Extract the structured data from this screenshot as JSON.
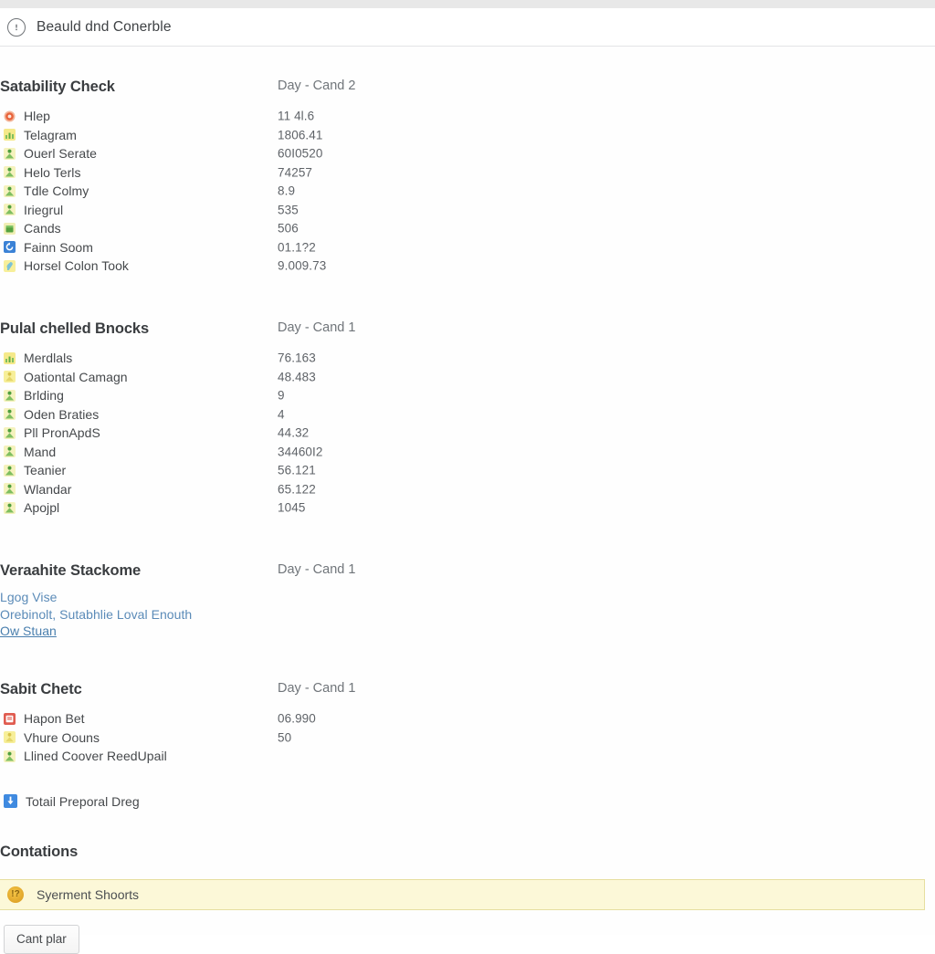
{
  "header": {
    "icon": "info-circle-icon",
    "title": "Beauld dnd Conerble"
  },
  "sections": [
    {
      "id": "satability-check",
      "title": "Satability Check",
      "meta": "Day - Cand 2",
      "rows": [
        {
          "icon": "orange-target-icon",
          "label": "Hlep",
          "value": "11 4l.6"
        },
        {
          "icon": "green-chart-icon",
          "label": "Telagram",
          "value": "1806.41"
        },
        {
          "icon": "green-person-icon",
          "label": "Ouerl Serate",
          "value": "60I0520"
        },
        {
          "icon": "green-person-icon",
          "label": "Helo Terls",
          "value": "74257"
        },
        {
          "icon": "green-person-icon",
          "label": "Tdle Colmy",
          "value": "8.9"
        },
        {
          "icon": "green-person-icon",
          "label": "Iriegrul",
          "value": "535"
        },
        {
          "icon": "green-box-icon",
          "label": "Cands",
          "value": "506"
        },
        {
          "icon": "blue-refresh-icon",
          "label": "Fainn Soom",
          "value": "01.1?2"
        },
        {
          "icon": "yellow-key-icon",
          "label": "Horsel Colon Took",
          "value": "9.009.73"
        }
      ]
    },
    {
      "id": "pulal-chelled-bnocks",
      "title": "Pulal chelled Bnocks",
      "meta": "Day - Cand 1",
      "rows": [
        {
          "icon": "green-chart-icon",
          "label": "Merdlals",
          "value": "76.163"
        },
        {
          "icon": "yellow-person-icon",
          "label": "Oationtal Camagn",
          "value": "48.483"
        },
        {
          "icon": "green-person-icon",
          "label": "Brlding",
          "value": "9"
        },
        {
          "icon": "green-person-icon",
          "label": "Oden Braties",
          "value": "4"
        },
        {
          "icon": "green-person-icon",
          "label": "Pll PronApdS",
          "value": "44.32"
        },
        {
          "icon": "green-person-icon",
          "label": "Mand",
          "value": "34460I2"
        },
        {
          "icon": "green-person-icon",
          "label": "Teanier",
          "value": "56.121"
        },
        {
          "icon": "green-person-icon",
          "label": "Wlandar",
          "value": "65.122"
        },
        {
          "icon": "green-person-icon",
          "label": "Apojpl",
          "value": "1045"
        }
      ]
    },
    {
      "id": "veraahite-stackome",
      "title": "Veraahite Stackome",
      "meta": "Day - Cand 1",
      "links": [
        {
          "text": "Lgog Vise",
          "underline": false
        },
        {
          "text": "Orebinolt, Sutabhlie Loval Enouth",
          "underline": false
        },
        {
          "text": "Ow Stuan",
          "underline": true
        }
      ]
    },
    {
      "id": "sabit-chetc",
      "title": "Sabit Chetc",
      "meta": "Day - Cand 1",
      "rows": [
        {
          "icon": "red-card-icon",
          "label": "Hapon Bet",
          "value": "06.990"
        },
        {
          "icon": "yellow-person-icon",
          "label": "Vhure Oouns",
          "value": "50"
        },
        {
          "icon": "green-person-icon",
          "label": "Llined Coover ReedUpail",
          "value": ""
        }
      ],
      "extra_rows": [
        {
          "icon": "blue-download-icon",
          "label": "Totail Preporal Dreg",
          "value": ""
        }
      ]
    },
    {
      "id": "contations",
      "title": "Contations",
      "meta": "",
      "banner": {
        "icon": "warning-badge-icon",
        "badge_text": "!?",
        "text": "Syerment Shoorts"
      }
    }
  ],
  "footer": {
    "cancel_label": "Cant plar"
  },
  "colors": {
    "top_strip": "#e8e8e8",
    "header_border": "#e3e4e6",
    "title_text": "#3a3d40",
    "meta_text": "#70757a",
    "label_text": "#45484b",
    "value_text": "#5f6368",
    "link_text": "#5b8bb8",
    "banner_bg": "#fcf8d8",
    "banner_border": "#e6dfa0",
    "button_border": "#d2d3d5",
    "icon_orange": "#e8623a",
    "icon_green": "#7fbf5f",
    "icon_yellow": "#f5e98a",
    "icon_blue": "#3b82d6",
    "icon_red": "#e05c50"
  }
}
